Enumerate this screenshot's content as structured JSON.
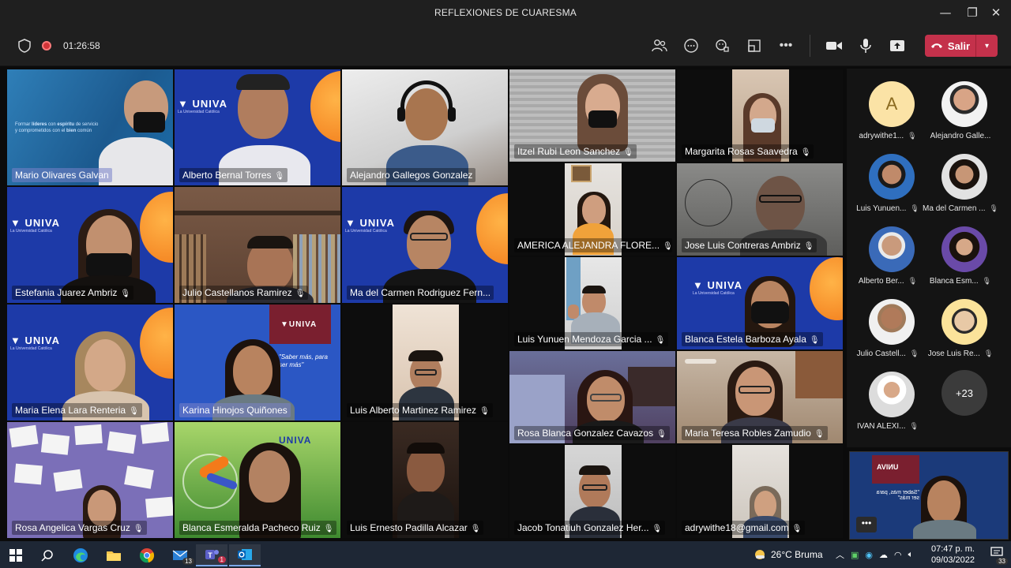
{
  "window": {
    "title": "REFLEXIONES DE CUARESMA",
    "minimize": "—",
    "maximize": "❐",
    "close": "✕"
  },
  "toolbar": {
    "timer": "01:26:58",
    "leave_label": "Salir"
  },
  "tiles": [
    {
      "name": "Mario Olivares Galvan",
      "mic": false,
      "highlight": true
    },
    {
      "name": "Alberto Bernal Torres",
      "mic": true
    },
    {
      "name": "Alejandro Gallegos Gonzalez",
      "mic": false
    },
    {
      "name": "Itzel Rubi Leon Sanchez",
      "mic": true
    },
    {
      "name": "Margarita Rosas Saavedra",
      "mic": true
    },
    {
      "name": "Estefania Juarez Ambriz",
      "mic": true
    },
    {
      "name": "Julio Castellanos Ramirez",
      "mic": true
    },
    {
      "name": "Ma del Carmen Rodriguez Fern...",
      "mic": false
    },
    {
      "name": "AMERICA ALEJANDRA FLORE...",
      "mic": true
    },
    {
      "name": "Jose Luis Contreras Ambriz",
      "mic": true
    },
    {
      "name": "Luis Yunuen Mendoza Garcia ...",
      "mic": true
    },
    {
      "name": "Blanca Estela Barboza Ayala",
      "mic": true
    },
    {
      "name": "Maria Elena Lara Renteria",
      "mic": true
    },
    {
      "name": "Karina Hinojos Quiñones",
      "mic": false,
      "highlight": true
    },
    {
      "name": "Luis Alberto Martinez Ramirez",
      "mic": true
    },
    {
      "name": "Rosa Blanca Gonzalez Cavazos",
      "mic": true
    },
    {
      "name": "Maria Teresa Robles Zamudio",
      "mic": true
    },
    {
      "name": "Rosa Angelica Vargas Cruz",
      "mic": true
    },
    {
      "name": "Blanca Esmeralda Pacheco Ruiz",
      "mic": true
    },
    {
      "name": "Luis Ernesto Padilla Alcazar",
      "mic": true
    },
    {
      "name": "Jacob Tonatiuh Gonzalez Her...",
      "mic": true
    },
    {
      "name": "adrywithe18@gmail.com",
      "mic": true
    }
  ],
  "brand": {
    "univa": "UNIVA",
    "univa_sub": "La Universidad Católica",
    "slogan": "\"Saber más, para ser más\""
  },
  "panel": {
    "participants": [
      {
        "name": "adrywithe1...",
        "initial": "A"
      },
      {
        "name": "Alejandro Galle..."
      },
      {
        "name": "Luis Yunuen..."
      },
      {
        "name": "Ma del Carmen ..."
      },
      {
        "name": "Alberto Ber..."
      },
      {
        "name": "Blanca Esm..."
      },
      {
        "name": "Julio Castell..."
      },
      {
        "name": "Jose Luis Re..."
      },
      {
        "name": "IVAN ALEXI..."
      }
    ],
    "more_count": "+23"
  },
  "taskbar": {
    "weather": "26°C  Bruma",
    "time": "07:47 p. m.",
    "date": "09/03/2022",
    "mail_badge": "13",
    "teams_badge": "1",
    "notif_count": "33"
  },
  "colors": {
    "leave": "#c4314b",
    "univa_blue": "#1d3aa8",
    "univa_orange": "#f27a1a"
  }
}
